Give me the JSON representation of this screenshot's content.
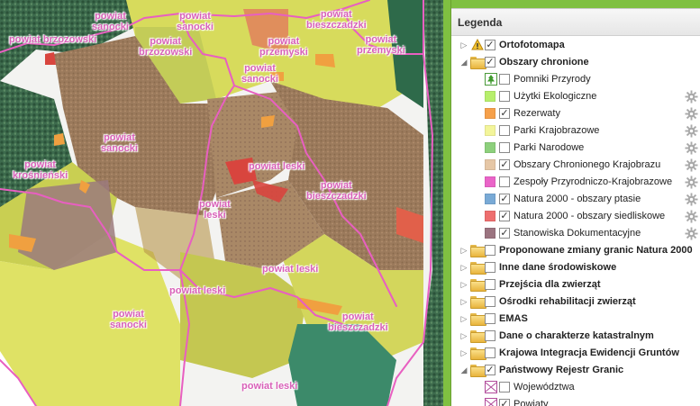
{
  "map": {
    "labels": [
      {
        "id": "powiat-sanocki-1",
        "text": "powiat\nsanocki"
      },
      {
        "id": "powiat-sanocki-2",
        "text": "powiat\nsanocki"
      },
      {
        "id": "powiat-bieszczadzki-1",
        "text": "powiat\nbieszczadzki"
      },
      {
        "id": "powiat-brzozowski-1",
        "text": "powiat brzozowski"
      },
      {
        "id": "powiat-brzozowski-2",
        "text": "powiat\nbrzozowski"
      },
      {
        "id": "powiat-przemyski-1",
        "text": "powiat\nprzemyski"
      },
      {
        "id": "powiat-przemyski-2",
        "text": "powiat\nprzemyski"
      },
      {
        "id": "powiat-sanocki-3",
        "text": "powiat\nsanocki"
      },
      {
        "id": "powiat-sanocki-4",
        "text": "powiat\nsanocki"
      },
      {
        "id": "powiat-krosnienski",
        "text": "powiat\nkrośnieński"
      },
      {
        "id": "powiat-leski-1",
        "text": "powiat leski"
      },
      {
        "id": "powiat-leski-2",
        "text": "powiat\nleski"
      },
      {
        "id": "powiat-bieszczadzki-2",
        "text": "powiat\nbieszczadzki"
      },
      {
        "id": "powiat-leski-3",
        "text": "powiat leski"
      },
      {
        "id": "powiat-leski-4",
        "text": "powiat leski"
      },
      {
        "id": "powiat-sanocki-5",
        "text": "powiat\nsanocki"
      },
      {
        "id": "powiat-bieszczadzki-3",
        "text": "powiat\nbieszczadzki"
      },
      {
        "id": "powiat-leski-5",
        "text": "powiat leski"
      }
    ]
  },
  "legend": {
    "title": "Legenda",
    "rows": [
      {
        "level": 0,
        "expander": "▷",
        "icon": "bulb-warning-icon",
        "checked": true,
        "label": "Ortofotomapa",
        "bold": true,
        "gear": false
      },
      {
        "level": 0,
        "expander": "◢",
        "icon": "folder-icon",
        "checked": true,
        "label": "Obszary chronione",
        "bold": true,
        "gear": false
      },
      {
        "level": 1,
        "icon": "nature-monument-icon",
        "checked": false,
        "label": "Pomniki Przyrody",
        "bold": false,
        "gear": false
      },
      {
        "level": 1,
        "swatch": "#b7ef6c",
        "checked": false,
        "label": "Użytki Ekologiczne",
        "bold": false,
        "gear": true
      },
      {
        "level": 1,
        "swatch": "#f6a04a",
        "checked": true,
        "label": "Rezerwaty",
        "bold": false,
        "gear": true
      },
      {
        "level": 1,
        "swatch": "#f3f59a",
        "checked": false,
        "label": "Parki Krajobrazowe",
        "bold": false,
        "gear": true
      },
      {
        "level": 1,
        "swatch": "#8dd07c",
        "checked": false,
        "label": "Parki Narodowe",
        "bold": false,
        "gear": true
      },
      {
        "level": 1,
        "swatch": "#e6c7a6",
        "checked": true,
        "label": "Obszary Chronionego Krajobrazu",
        "bold": false,
        "gear": true
      },
      {
        "level": 1,
        "swatch": "#ea64c8",
        "checked": false,
        "label": "Zespoły Przyrodniczo-Krajobrazowe",
        "bold": false,
        "gear": true
      },
      {
        "level": 1,
        "swatch": "#79aad6",
        "checked": true,
        "label": "Natura 2000 - obszary ptasie",
        "bold": false,
        "gear": true
      },
      {
        "level": 1,
        "swatch": "#ee6e6e",
        "checked": true,
        "label": "Natura 2000 - obszary siedliskowe",
        "bold": false,
        "gear": true
      },
      {
        "level": 1,
        "swatch": "#9b7480",
        "checked": true,
        "label": "Stanowiska Dokumentacyjne",
        "bold": false,
        "gear": true
      },
      {
        "level": 0,
        "expander": "▷",
        "icon": "folder-icon",
        "checked": false,
        "label": "Proponowane zmiany granic Natura 2000",
        "bold": true,
        "gear": false
      },
      {
        "level": 0,
        "expander": "▷",
        "icon": "folder-icon",
        "checked": false,
        "label": "Inne dane środowiskowe",
        "bold": true,
        "gear": false
      },
      {
        "level": 0,
        "expander": "▷",
        "icon": "folder-icon",
        "checked": false,
        "label": "Przejścia dla zwierząt",
        "bold": true,
        "gear": false
      },
      {
        "level": 0,
        "expander": "▷",
        "icon": "folder-icon",
        "checked": false,
        "label": "Ośrodki rehabilitacji zwierząt",
        "bold": true,
        "gear": false
      },
      {
        "level": 0,
        "expander": "▷",
        "icon": "folder-icon",
        "checked": false,
        "label": "EMAS",
        "bold": true,
        "gear": false
      },
      {
        "level": 0,
        "expander": "▷",
        "icon": "folder-icon",
        "checked": false,
        "label": "Dane o charakterze katastralnym",
        "bold": true,
        "gear": false
      },
      {
        "level": 0,
        "expander": "▷",
        "icon": "folder-icon",
        "checked": false,
        "label": "Krajowa Integracja Ewidencji Gruntów",
        "bold": true,
        "gear": false
      },
      {
        "level": 0,
        "expander": "◢",
        "icon": "folder-icon",
        "checked": true,
        "label": "Państwowy Rejestr Granic",
        "bold": true,
        "gear": false
      },
      {
        "level": 1,
        "icon": "boundary-line-icon",
        "checked": false,
        "label": "Województwa",
        "bold": false,
        "gear": false
      },
      {
        "level": 1,
        "icon": "boundary-line-icon",
        "checked": true,
        "label": "Powiaty",
        "bold": false,
        "gear": false
      }
    ]
  }
}
